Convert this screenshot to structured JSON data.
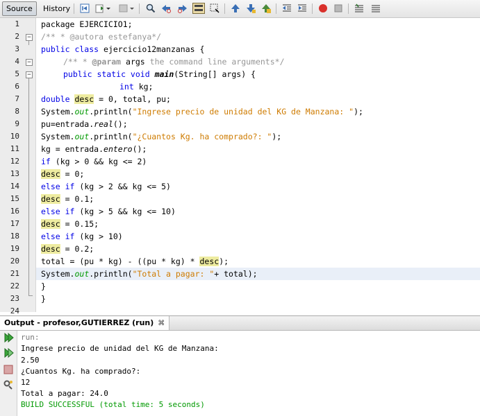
{
  "toolbar": {
    "source_label": "Source",
    "history_label": "History"
  },
  "editor": {
    "line_numbers": [
      "1",
      "2",
      "3",
      "4",
      "5",
      "6",
      "7",
      "8",
      "9",
      "10",
      "11",
      "12",
      "13",
      "14",
      "15",
      "16",
      "17",
      "18",
      "19",
      "20",
      "21",
      "22",
      "23",
      "24"
    ],
    "line1": {
      "t1": "package EJERCICIO1;"
    },
    "line2": {
      "t1": "/** * @autora estefanya*/"
    },
    "line3": {
      "k1": "public class",
      "t1": " ejercicio12manzanas {"
    },
    "line4": {
      "c1": "/** * ",
      "c2": "@param",
      "c3": " args",
      "c4": " the command line arguments*/"
    },
    "line5": {
      "k1": "public static void",
      "t1": " ",
      "m1": "main",
      "t2": "(String[] args) {"
    },
    "line6": {
      "k1": "int",
      "t1": " kg;"
    },
    "line7": {
      "k1": "double",
      "t1": " ",
      "v1": "desc",
      "t2": " = 0, total, pu;"
    },
    "line8": {
      "t1": "System.",
      "f1": "out",
      "t2": ".println(",
      "s1": "\"Ingrese precio de unidad del KG de Manzana: \"",
      "t3": ");"
    },
    "line9": {
      "t1": "pu=entrada.",
      "i1": "real",
      "t2": "();"
    },
    "line10": {
      "t1": "System.",
      "f1": "out",
      "t2": ".println(",
      "s1": "\"¿Cuantos Kg. ha comprado?: \"",
      "t3": ");"
    },
    "line11": {
      "t1": "kg = entrada.",
      "i1": "entero",
      "t2": "();"
    },
    "line12": {
      "k1": "if",
      "t1": " (kg > 0 && kg <= 2)"
    },
    "line13": {
      "v1": "desc",
      "t1": " = 0;"
    },
    "line14": {
      "k1": "else if",
      "t1": " (kg > 2 && kg <= 5)"
    },
    "line15": {
      "v1": "desc",
      "t1": " = 0.1;"
    },
    "line16": {
      "k1": "else if",
      "t1": " (kg > 5 && kg <= 10)"
    },
    "line17": {
      "v1": "desc",
      "t1": " = 0.15;"
    },
    "line18": {
      "k1": "else if",
      "t1": " (kg > 10)"
    },
    "line19": {
      "v1": "desc",
      "t1": " = 0.2;"
    },
    "line20": {
      "t1": "total = (pu * kg) - ((pu * kg) * ",
      "v1": "desc",
      "t2": ");"
    },
    "line21": {
      "t1": "System.",
      "f1": "out",
      "t2": ".println(",
      "s1": "\"Total a pagar: \"",
      "t3": "+ total);"
    },
    "line22": {
      "t1": "}"
    },
    "line23": {
      "t1": "}"
    }
  },
  "output": {
    "tab_title": "Output - profesor,GUTIERREZ (run)",
    "close_glyph": "⌘",
    "lines": [
      "run:",
      "Ingrese precio de unidad del KG de Manzana:",
      "2.50",
      "¿Cuantos Kg. ha comprado?:",
      "12",
      "Total a pagar: 24.0",
      "BUILD SUCCESSFUL (total time: 5 seconds)"
    ]
  },
  "colors": {
    "keyword": "#0000e6",
    "string": "#ce7b00",
    "comment": "#969696",
    "field": "#009900",
    "occurrence_highlight": "#eeeca0",
    "current_line": "#e9eff8"
  },
  "icons": {
    "toolbar": [
      "back-icon",
      "history-icon",
      "history-dropdown-icon",
      "find-icon",
      "find-prev-icon",
      "find-next-icon",
      "toggle-highlight-icon",
      "rect-select-icon",
      "prev-bookmark-icon",
      "next-bookmark-icon",
      "toggle-bookmark-icon",
      "shift-left-icon",
      "shift-right-icon",
      "record-macro-icon",
      "stop-macro-icon",
      "comment-icon",
      "uncomment-icon"
    ],
    "output": [
      "rerun-icon",
      "rerun-different-icon",
      "stop-icon",
      "settings-icon"
    ]
  }
}
